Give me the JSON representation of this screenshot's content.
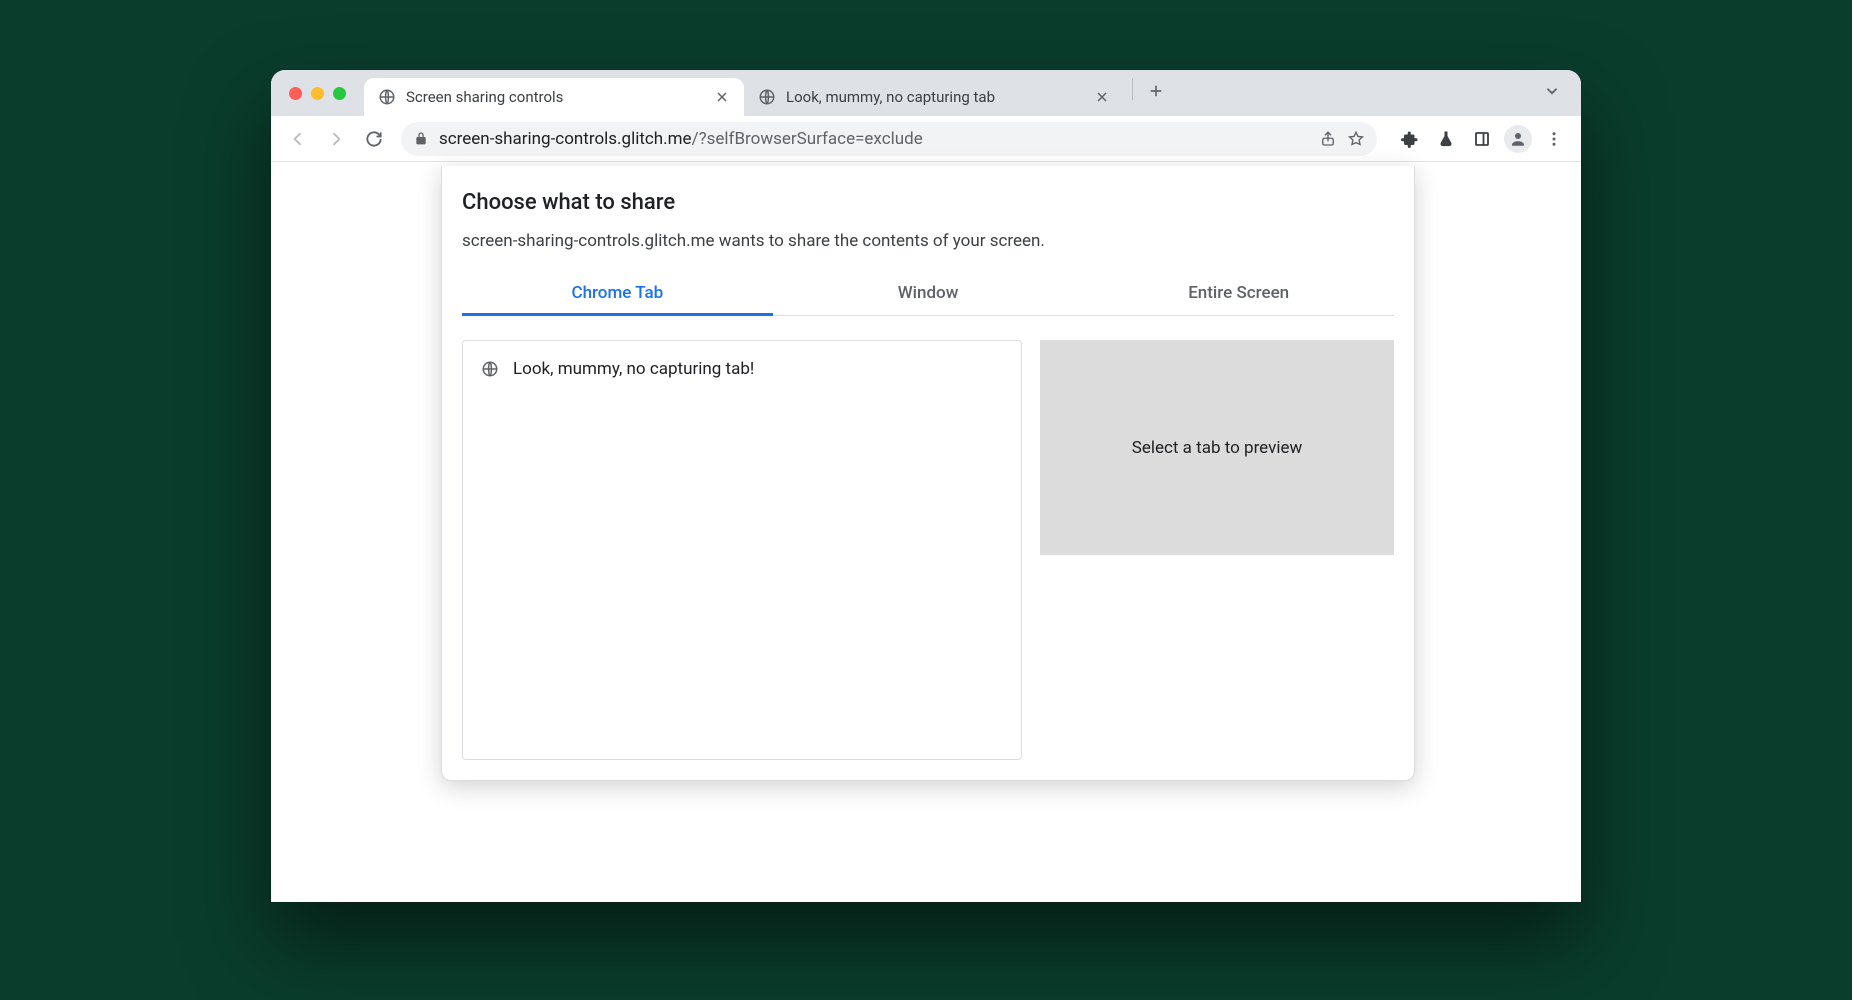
{
  "browser": {
    "tabs": [
      {
        "title": "Screen sharing controls",
        "active": true
      },
      {
        "title": "Look, mummy, no capturing tab",
        "active": false
      }
    ],
    "url_host": "screen-sharing-controls.glitch.me",
    "url_path": "/?selfBrowserSurface=exclude"
  },
  "panel": {
    "title": "Choose what to share",
    "description": "screen-sharing-controls.glitch.me wants to share the contents of your screen.",
    "share_tabs": [
      "Chrome Tab",
      "Window",
      "Entire Screen"
    ],
    "active_share_tab": 0,
    "tab_list": [
      {
        "title": "Look, mummy, no capturing tab!"
      }
    ],
    "preview_text": "Select a tab to preview"
  }
}
